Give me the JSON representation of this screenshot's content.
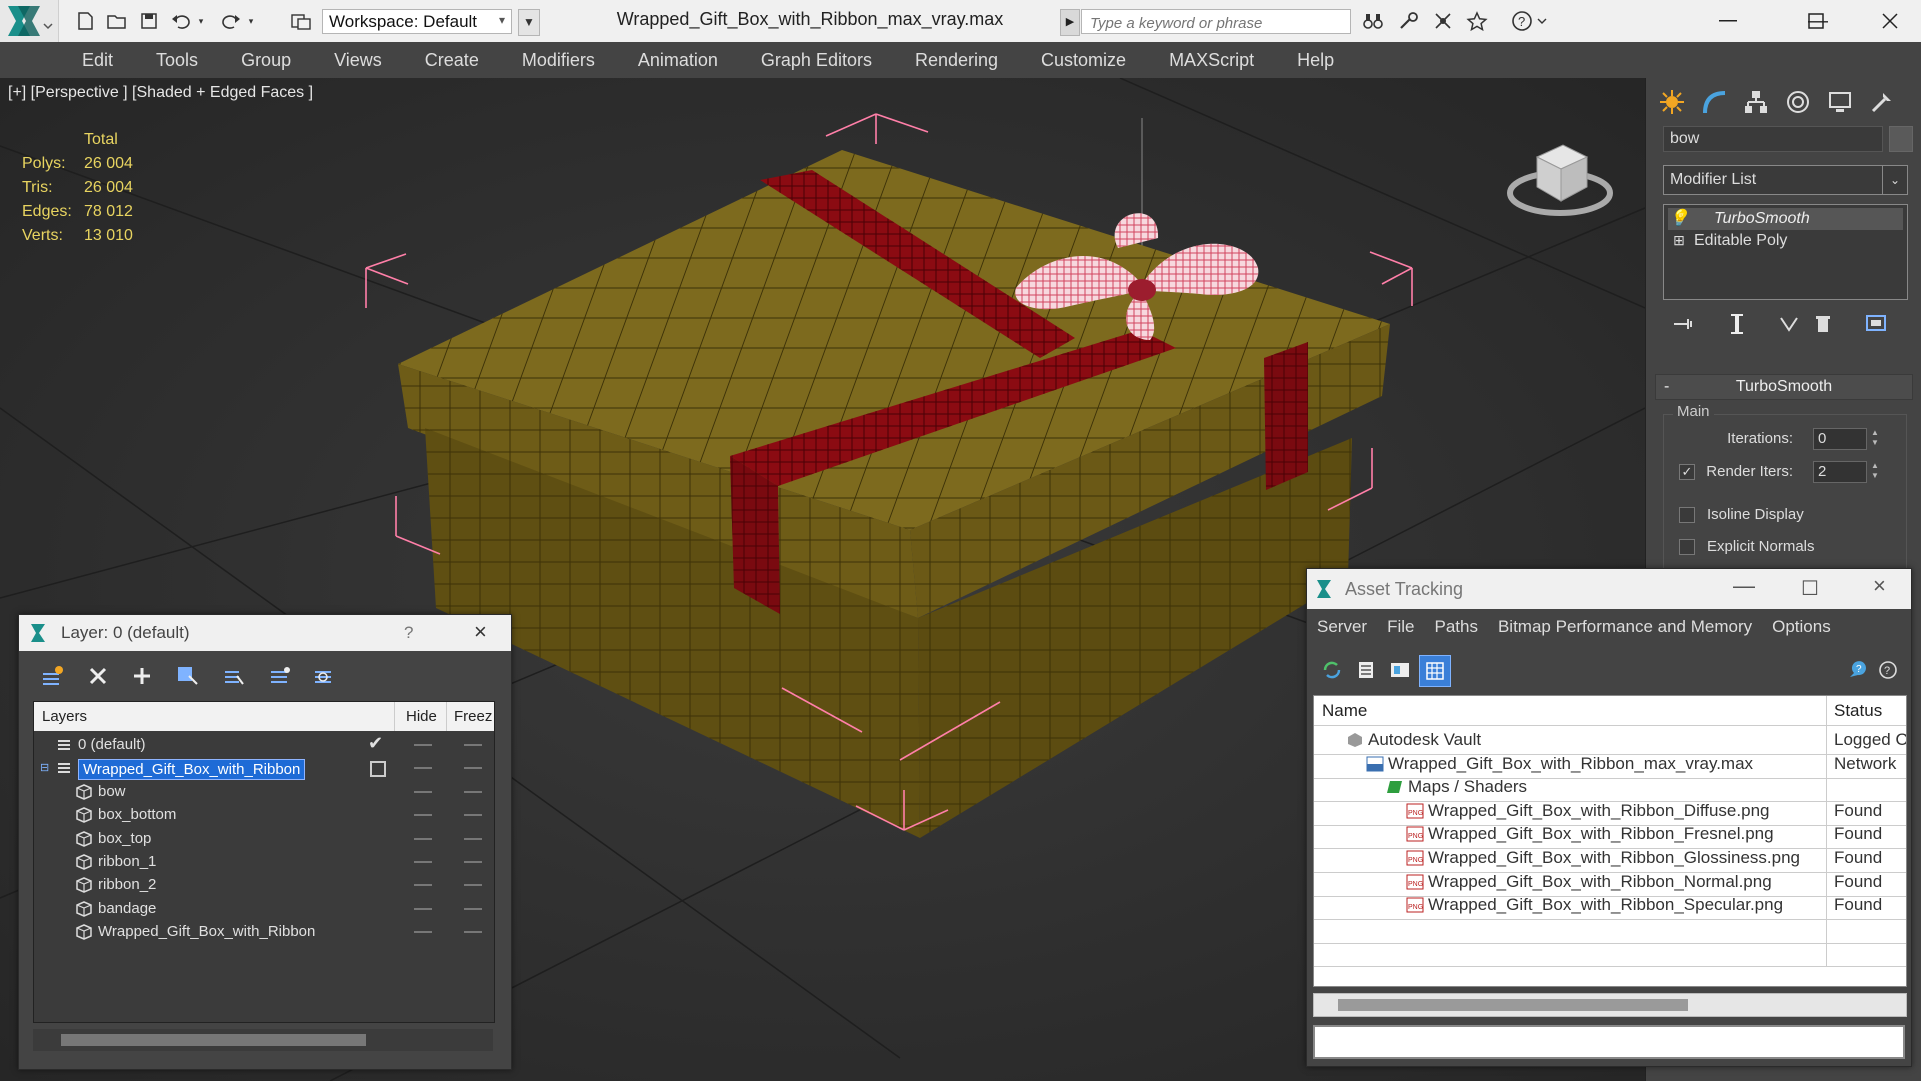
{
  "window": {
    "title": "Wrapped_Gift_Box_with_Ribbon_max_vray.max",
    "workspace": "Workspace: Default",
    "search_placeholder": "Type a keyword or phrase"
  },
  "menu": [
    "Edit",
    "Tools",
    "Group",
    "Views",
    "Create",
    "Modifiers",
    "Animation",
    "Graph Editors",
    "Rendering",
    "Customize",
    "MAXScript",
    "Help"
  ],
  "viewport": {
    "label": "[+] [Perspective ] [Shaded + Edged Faces ]",
    "stats_header": "Total",
    "stats": [
      {
        "label": "Polys:",
        "value": "26 004"
      },
      {
        "label": "Tris:",
        "value": "26 004"
      },
      {
        "label": "Edges:",
        "value": "78 012"
      },
      {
        "label": "Verts:",
        "value": "13 010"
      }
    ]
  },
  "command_panel": {
    "object_name": "bow",
    "modifier_list": "Modifier List",
    "stack": [
      "TurboSmooth",
      "Editable Poly"
    ],
    "rollout_title": "TurboSmooth",
    "group_label": "Main",
    "iterations_label": "Iterations:",
    "iterations_value": "0",
    "render_iters_label": "Render Iters:",
    "render_iters_value": "2",
    "render_iters_checked": true,
    "isoline_label": "Isoline Display",
    "explicit_normals_label": "Explicit Normals"
  },
  "layer_explorer": {
    "title": "Layer: 0 (default)",
    "help": "?",
    "columns": {
      "layers": "Layers",
      "hide": "Hide",
      "freeze": "Freez"
    },
    "rows": [
      {
        "name": "0 (default)",
        "type": "layer"
      },
      {
        "name": "Wrapped_Gift_Box_with_Ribbon",
        "type": "layer",
        "selected": true
      },
      {
        "name": "bow",
        "type": "object"
      },
      {
        "name": "box_bottom",
        "type": "object"
      },
      {
        "name": "box_top",
        "type": "object"
      },
      {
        "name": "ribbon_1",
        "type": "object"
      },
      {
        "name": "ribbon_2",
        "type": "object"
      },
      {
        "name": "bandage",
        "type": "object"
      },
      {
        "name": "Wrapped_Gift_Box_with_Ribbon",
        "type": "object"
      }
    ]
  },
  "asset_tracking": {
    "title": "Asset Tracking",
    "menu": [
      "Server",
      "File",
      "Paths",
      "Bitmap Performance and Memory",
      "Options"
    ],
    "columns": {
      "name": "Name",
      "status": "Status"
    },
    "rows": [
      {
        "name": "Autodesk Vault",
        "status": "Logged O",
        "indent": 1,
        "icon": "vault-icon"
      },
      {
        "name": "Wrapped_Gift_Box_with_Ribbon_max_vray.max",
        "status": "Network",
        "indent": 2,
        "icon": "max-file-icon"
      },
      {
        "name": "Maps / Shaders",
        "status": "",
        "indent": 3,
        "icon": "maps-folder-icon"
      },
      {
        "name": "Wrapped_Gift_Box_with_Ribbon_Diffuse.png",
        "status": "Found",
        "indent": 4,
        "icon": "png-icon"
      },
      {
        "name": "Wrapped_Gift_Box_with_Ribbon_Fresnel.png",
        "status": "Found",
        "indent": 4,
        "icon": "png-icon"
      },
      {
        "name": "Wrapped_Gift_Box_with_Ribbon_Glossiness.png",
        "status": "Found",
        "indent": 4,
        "icon": "png-icon"
      },
      {
        "name": "Wrapped_Gift_Box_with_Ribbon_Normal.png",
        "status": "Found",
        "indent": 4,
        "icon": "png-icon"
      },
      {
        "name": "Wrapped_Gift_Box_with_Ribbon_Specular.png",
        "status": "Found",
        "indent": 4,
        "icon": "png-icon"
      }
    ]
  },
  "colors": {
    "stats_text": "#e8d460",
    "selection": "#1e6bd6",
    "ribbon": "#8b0b12",
    "box": "#7d6a1e",
    "bbox": "#ff7fa8"
  }
}
